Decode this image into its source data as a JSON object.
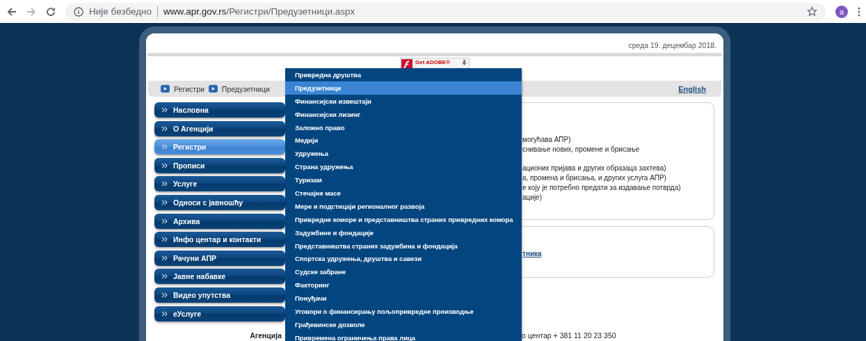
{
  "browser": {
    "insecure_label": "Није безбедно",
    "url_host": "www.apr.gov.rs",
    "url_path": "/Регистри/Предузетници.aspx",
    "avatar_letter": "a"
  },
  "header": {
    "date": "среда 19. децембар 2018.",
    "flash_badge": [
      "Get ADOBE®"
    ]
  },
  "breadcrumb": [
    "Регистри",
    "Предузетници"
  ],
  "language_link": "English",
  "nav": [
    {
      "label": "Насловна",
      "selected": false
    },
    {
      "label": "О Агенцији",
      "selected": false
    },
    {
      "label": "Регистри",
      "selected": true
    },
    {
      "label": "Прописи",
      "selected": false
    },
    {
      "label": "Услуге",
      "selected": false
    },
    {
      "label": "Односи с јавношћу",
      "selected": false
    },
    {
      "label": "Архива",
      "selected": false
    },
    {
      "label": "Инфо центар и контакти",
      "selected": false
    },
    {
      "label": "Рачуни АПР",
      "selected": false
    },
    {
      "label": "Јавне набавке",
      "selected": false
    },
    {
      "label": "Видео упутства",
      "selected": false
    },
    {
      "label": "еУслуге",
      "selected": false
    }
  ],
  "dropdown": [
    {
      "label": "Привредна друштва",
      "selected": false
    },
    {
      "label": "Предузетници",
      "selected": true
    },
    {
      "label": "Финансијски извештаји",
      "selected": false
    },
    {
      "label": "Финансијски лизинг",
      "selected": false
    },
    {
      "label": "Заложно право",
      "selected": false
    },
    {
      "label": "Медији",
      "selected": false
    },
    {
      "label": "Удружења",
      "selected": false
    },
    {
      "label": "Страна удружења",
      "selected": false
    },
    {
      "label": "Туризам",
      "selected": false
    },
    {
      "label": "Стечајне масе",
      "selected": false
    },
    {
      "label": "Мере и подстицаји регионалног развоја",
      "selected": false
    },
    {
      "label": "Привредне коморе и представништва страних привредних комора",
      "selected": false
    },
    {
      "label": "Задужбине и фондације",
      "selected": false
    },
    {
      "label": "Представништва страних задужбина и фондација",
      "selected": false
    },
    {
      "label": "Спортска удружења, друштва и савези",
      "selected": false
    },
    {
      "label": "Судске забране",
      "selected": false
    },
    {
      "label": "Факторинг",
      "selected": false
    },
    {
      "label": "Понуђачи",
      "selected": false
    },
    {
      "label": "Уговори о финансирању пољопривредне производње",
      "selected": false
    },
    {
      "label": "Грађевинске дозволе",
      "selected": false
    },
    {
      "label": "Привремена ограничења права лица",
      "selected": false
    }
  ],
  "card_lines": [
    [
      "могућава АПР)",
      "снивање нових, промене и брисање"
    ],
    [
      "ационих пријава и других образаца захтева)",
      "а, промена и брисања, и других услуга АПР)",
      "е коју је потребно предати за издавање потврда)",
      "ације)"
    ]
  ],
  "card_link": "тника",
  "footer": {
    "left": "Агенција",
    "right": "о центар + 381 11 20 23 350"
  }
}
